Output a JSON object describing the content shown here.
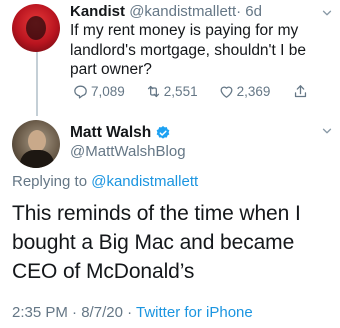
{
  "tweet1": {
    "display_name": "Kandist",
    "handle": "@kandistmallett",
    "separator": "·",
    "age": "6d",
    "text": "If my rent money is paying for my landlord's mortgage, shouldn't I be part owner?",
    "replies": "7,089",
    "retweets": "2,551",
    "likes": "2,369"
  },
  "tweet2": {
    "display_name": "Matt Walsh",
    "handle": "@MattWalshBlog",
    "replying_prefix": "Replying to",
    "replying_handle": "@kandistmallett",
    "text": "This reminds of the time when I bought a Big Mac and became CEO of McDonald’s",
    "time": "2:35 PM",
    "date": "8/7/20",
    "sep1": "·",
    "sep2": "·",
    "source": "Twitter for iPhone"
  },
  "icons": {
    "reply": "reply-icon",
    "retweet": "retweet-icon",
    "like": "heart-icon",
    "share": "share-icon",
    "verified": "verified-badge-icon",
    "more": "chevron-down-icon"
  },
  "colors": {
    "link": "#1b95e0",
    "verified": "#1da1f2",
    "muted": "#657786",
    "text": "#14171a"
  }
}
